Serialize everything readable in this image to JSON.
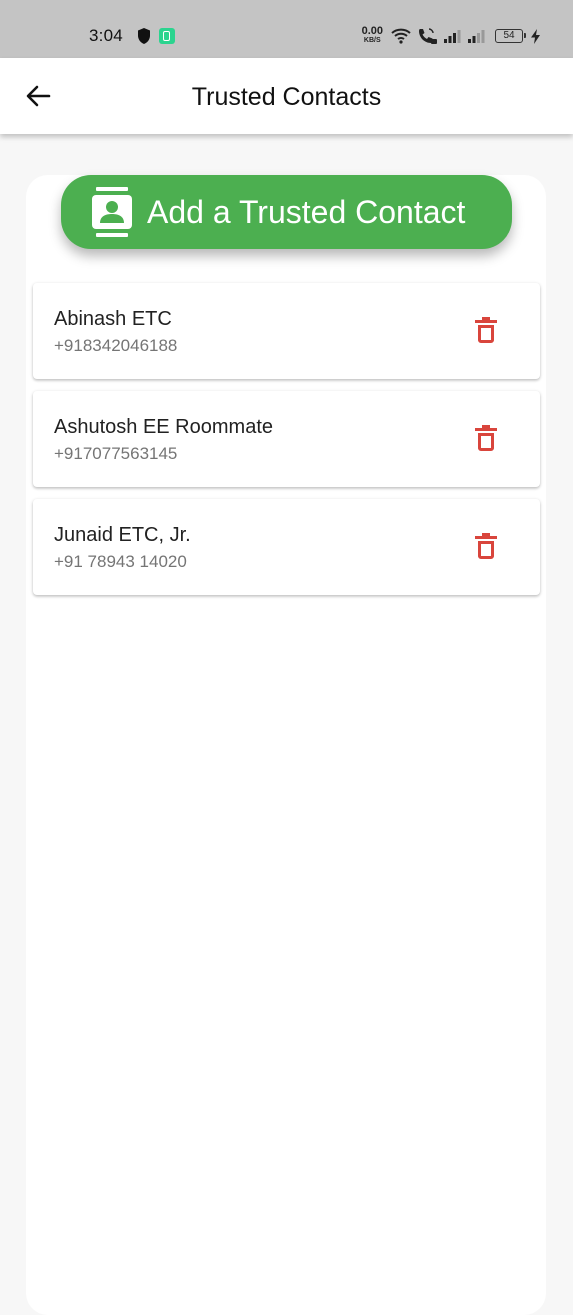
{
  "status_bar": {
    "time": "3:04",
    "net_speed_value": "0.00",
    "net_speed_unit": "KB/S",
    "battery_level": "54"
  },
  "app_bar": {
    "title": "Trusted Contacts",
    "back_icon": "arrow-left-icon"
  },
  "add_button": {
    "label": "Add a Trusted Contact",
    "icon": "contact-book-icon"
  },
  "contacts": [
    {
      "name": "Abinash ETC",
      "phone": "+918342046188"
    },
    {
      "name": "Ashutosh EE Roommate",
      "phone": "+917077563145"
    },
    {
      "name": "Junaid ETC, Jr.",
      "phone": "+91 78943 14020"
    }
  ],
  "colors": {
    "accent_green": "#4caf50",
    "delete_red": "#d9453c",
    "status_bar_bg": "#c4c4c4"
  }
}
